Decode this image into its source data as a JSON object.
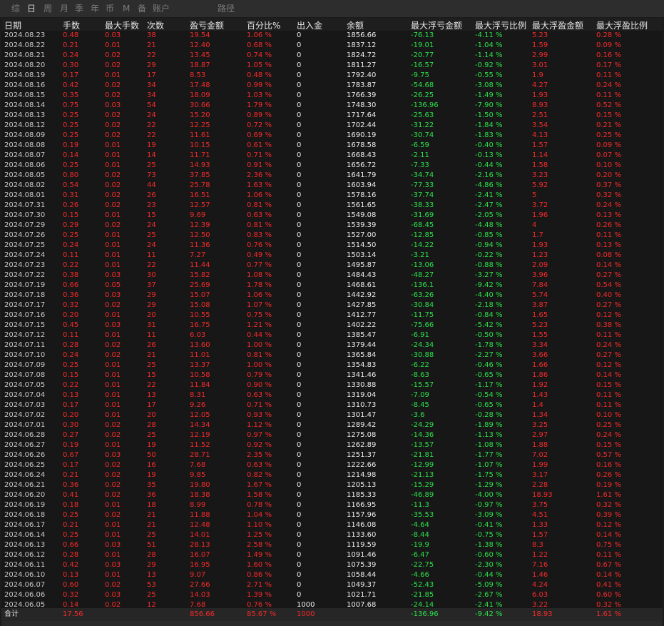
{
  "tabs": [
    {
      "label": "综",
      "active": false
    },
    {
      "label": "日",
      "active": true
    },
    {
      "label": "周",
      "active": false
    },
    {
      "label": "月",
      "active": false
    },
    {
      "label": "季",
      "active": false
    },
    {
      "label": "年",
      "active": false
    },
    {
      "label": "币",
      "active": false
    },
    {
      "label": "M",
      "active": false
    },
    {
      "label": "备",
      "active": false
    },
    {
      "label": "账户",
      "active": false
    },
    {
      "label": "路径",
      "active": false
    }
  ],
  "columns": [
    "日期",
    "手数",
    "最大手数",
    "次数",
    "盈亏金额",
    "百分比%",
    "出入金",
    "余额",
    "最大浮亏金额",
    "最大浮亏比例",
    "最大浮盈金额",
    "最大浮盈比例"
  ],
  "rows": [
    [
      "2024.08.23",
      "0.48",
      "0.03",
      "38",
      "19.54",
      "1.06 %",
      "0",
      "1856.66",
      "-76.13",
      "-4.11 %",
      "5.23",
      "0.28 %"
    ],
    [
      "2024.08.22",
      "0.21",
      "0.01",
      "21",
      "12.40",
      "0.68 %",
      "0",
      "1837.12",
      "-19.01",
      "-1.04 %",
      "1.59",
      "0.09 %"
    ],
    [
      "2024.08.21",
      "0.24",
      "0.02",
      "22",
      "13.45",
      "0.74 %",
      "0",
      "1824.72",
      "-20.77",
      "-1.14 %",
      "2.99",
      "0.16 %"
    ],
    [
      "2024.08.20",
      "0.30",
      "0.02",
      "29",
      "18.87",
      "1.05 %",
      "0",
      "1811.27",
      "-16.57",
      "-0.92 %",
      "3.01",
      "0.17 %"
    ],
    [
      "2024.08.19",
      "0.17",
      "0.01",
      "17",
      "8.53",
      "0.48 %",
      "0",
      "1792.40",
      "-9.75",
      "-0.55 %",
      "1.9",
      "0.11 %"
    ],
    [
      "2024.08.16",
      "0.42",
      "0.02",
      "34",
      "17.48",
      "0.99 %",
      "0",
      "1783.87",
      "-54.68",
      "-3.08 %",
      "4.27",
      "0.24 %"
    ],
    [
      "2024.08.15",
      "0.35",
      "0.02",
      "34",
      "18.09",
      "1.03 %",
      "0",
      "1766.39",
      "-26.25",
      "-1.49 %",
      "1.93",
      "0.11 %"
    ],
    [
      "2024.08.14",
      "0.75",
      "0.03",
      "54",
      "30.66",
      "1.79 %",
      "0",
      "1748.30",
      "-136.96",
      "-7.90 %",
      "8.93",
      "0.52 %"
    ],
    [
      "2024.08.13",
      "0.25",
      "0.02",
      "24",
      "15.20",
      "0.89 %",
      "0",
      "1717.64",
      "-25.63",
      "-1.50 %",
      "2.51",
      "0.15 %"
    ],
    [
      "2024.08.12",
      "0.25",
      "0.02",
      "22",
      "12.25",
      "0.72 %",
      "0",
      "1702.44",
      "-31.22",
      "-1.84 %",
      "3.54",
      "0.21 %"
    ],
    [
      "2024.08.09",
      "0.25",
      "0.02",
      "22",
      "11.61",
      "0.69 %",
      "0",
      "1690.19",
      "-30.74",
      "-1.83 %",
      "4.13",
      "0.25 %"
    ],
    [
      "2024.08.08",
      "0.19",
      "0.01",
      "19",
      "10.15",
      "0.61 %",
      "0",
      "1678.58",
      "-6.59",
      "-0.40 %",
      "1.57",
      "0.09 %"
    ],
    [
      "2024.08.07",
      "0.14",
      "0.01",
      "14",
      "11.71",
      "0.71 %",
      "0",
      "1668.43",
      "-2.11",
      "-0.13 %",
      "1.14",
      "0.07 %"
    ],
    [
      "2024.08.06",
      "0.25",
      "0.01",
      "25",
      "14.93",
      "0.91 %",
      "0",
      "1656.72",
      "-7.33",
      "-0.44 %",
      "1.58",
      "0.10 %"
    ],
    [
      "2024.08.05",
      "0.80",
      "0.02",
      "73",
      "37.85",
      "2.36 %",
      "0",
      "1641.79",
      "-34.74",
      "-2.16 %",
      "3.23",
      "0.20 %"
    ],
    [
      "2024.08.02",
      "0.54",
      "0.02",
      "44",
      "25.78",
      "1.63 %",
      "0",
      "1603.94",
      "-77.33",
      "-4.86 %",
      "5.92",
      "0.37 %"
    ],
    [
      "2024.08.01",
      "0.31",
      "0.02",
      "26",
      "16.51",
      "1.06 %",
      "0",
      "1578.16",
      "-37.74",
      "-2.41 %",
      "5",
      "0.32 %"
    ],
    [
      "2024.07.31",
      "0.26",
      "0.02",
      "23",
      "12.57",
      "0.81 %",
      "0",
      "1561.65",
      "-38.33",
      "-2.47 %",
      "3.72",
      "0.24 %"
    ],
    [
      "2024.07.30",
      "0.15",
      "0.01",
      "15",
      "9.69",
      "0.63 %",
      "0",
      "1549.08",
      "-31.69",
      "-2.05 %",
      "1.96",
      "0.13 %"
    ],
    [
      "2024.07.29",
      "0.29",
      "0.02",
      "24",
      "12.39",
      "0.81 %",
      "0",
      "1539.39",
      "-68.45",
      "-4.48 %",
      "4",
      "0.26 %"
    ],
    [
      "2024.07.26",
      "0.25",
      "0.01",
      "25",
      "12.50",
      "0.83 %",
      "0",
      "1527.00",
      "-12.85",
      "-0.85 %",
      "1.7",
      "0.11 %"
    ],
    [
      "2024.07.25",
      "0.24",
      "0.01",
      "24",
      "11.36",
      "0.76 %",
      "0",
      "1514.50",
      "-14.22",
      "-0.94 %",
      "1.93",
      "0.13 %"
    ],
    [
      "2024.07.24",
      "0.11",
      "0.01",
      "11",
      "7.27",
      "0.49 %",
      "0",
      "1503.14",
      "-3.21",
      "-0.22 %",
      "1.23",
      "0.08 %"
    ],
    [
      "2024.07.23",
      "0.22",
      "0.01",
      "22",
      "11.44",
      "0.77 %",
      "0",
      "1495.87",
      "-13.06",
      "-0.88 %",
      "2.09",
      "0.14 %"
    ],
    [
      "2024.07.22",
      "0.38",
      "0.03",
      "30",
      "15.82",
      "1.08 %",
      "0",
      "1484.43",
      "-48.27",
      "-3.27 %",
      "3.96",
      "0.27 %"
    ],
    [
      "2024.07.19",
      "0.66",
      "0.05",
      "37",
      "25.69",
      "1.78 %",
      "0",
      "1468.61",
      "-136.1",
      "-9.42 %",
      "7.84",
      "0.54 %"
    ],
    [
      "2024.07.18",
      "0.36",
      "0.03",
      "29",
      "15.07",
      "1.06 %",
      "0",
      "1442.92",
      "-63.26",
      "-4.40 %",
      "5.74",
      "0.40 %"
    ],
    [
      "2024.07.17",
      "0.32",
      "0.02",
      "29",
      "15.08",
      "1.07 %",
      "0",
      "1427.85",
      "-30.84",
      "-2.18 %",
      "3.87",
      "0.27 %"
    ],
    [
      "2024.07.16",
      "0.20",
      "0.01",
      "20",
      "10.55",
      "0.75 %",
      "0",
      "1412.77",
      "-11.75",
      "-0.84 %",
      "1.65",
      "0.12 %"
    ],
    [
      "2024.07.15",
      "0.45",
      "0.03",
      "31",
      "16.75",
      "1.21 %",
      "0",
      "1402.22",
      "-75.66",
      "-5.42 %",
      "5.23",
      "0.38 %"
    ],
    [
      "2024.07.12",
      "0.11",
      "0.01",
      "11",
      "6.03",
      "0.44 %",
      "0",
      "1385.47",
      "-6.91",
      "-0.50 %",
      "1.55",
      "0.11 %"
    ],
    [
      "2024.07.11",
      "0.28",
      "0.02",
      "26",
      "13.60",
      "1.00 %",
      "0",
      "1379.44",
      "-24.34",
      "-1.78 %",
      "3.34",
      "0.24 %"
    ],
    [
      "2024.07.10",
      "0.24",
      "0.02",
      "21",
      "11.01",
      "0.81 %",
      "0",
      "1365.84",
      "-30.88",
      "-2.27 %",
      "3.66",
      "0.27 %"
    ],
    [
      "2024.07.09",
      "0.25",
      "0.01",
      "25",
      "13.37",
      "1.00 %",
      "0",
      "1354.83",
      "-6.22",
      "-0.46 %",
      "1.66",
      "0.12 %"
    ],
    [
      "2024.07.08",
      "0.15",
      "0.01",
      "15",
      "10.58",
      "0.79 %",
      "0",
      "1341.46",
      "-8.63",
      "-0.65 %",
      "1.86",
      "0.14 %"
    ],
    [
      "2024.07.05",
      "0.22",
      "0.01",
      "22",
      "11.84",
      "0.90 %",
      "0",
      "1330.88",
      "-15.57",
      "-1.17 %",
      "1.92",
      "0.15 %"
    ],
    [
      "2024.07.04",
      "0.13",
      "0.01",
      "13",
      "8.31",
      "0.63 %",
      "0",
      "1319.04",
      "-7.09",
      "-0.54 %",
      "1.43",
      "0.11 %"
    ],
    [
      "2024.07.03",
      "0.17",
      "0.01",
      "17",
      "9.26",
      "0.71 %",
      "0",
      "1310.73",
      "-8.45",
      "-0.65 %",
      "1.4",
      "0.11 %"
    ],
    [
      "2024.07.02",
      "0.20",
      "0.01",
      "20",
      "12.05",
      "0.93 %",
      "0",
      "1301.47",
      "-3.6",
      "-0.28 %",
      "1.34",
      "0.10 %"
    ],
    [
      "2024.07.01",
      "0.30",
      "0.02",
      "28",
      "14.34",
      "1.12 %",
      "0",
      "1289.42",
      "-24.29",
      "-1.89 %",
      "3.25",
      "0.25 %"
    ],
    [
      "2024.06.28",
      "0.27",
      "0.02",
      "25",
      "12.19",
      "0.97 %",
      "0",
      "1275.08",
      "-14.36",
      "-1.13 %",
      "2.97",
      "0.24 %"
    ],
    [
      "2024.06.27",
      "0.19",
      "0.01",
      "19",
      "11.52",
      "0.92 %",
      "0",
      "1262.89",
      "-13.57",
      "-1.08 %",
      "1.88",
      "0.15 %"
    ],
    [
      "2024.06.26",
      "0.67",
      "0.03",
      "50",
      "28.71",
      "2.35 %",
      "0",
      "1251.37",
      "-21.81",
      "-1.77 %",
      "7.02",
      "0.57 %"
    ],
    [
      "2024.06.25",
      "0.17",
      "0.02",
      "16",
      "7.68",
      "0.63 %",
      "0",
      "1222.66",
      "-12.99",
      "-1.07 %",
      "1.99",
      "0.16 %"
    ],
    [
      "2024.06.24",
      "0.21",
      "0.02",
      "19",
      "9.85",
      "0.82 %",
      "0",
      "1214.98",
      "-21.13",
      "-1.75 %",
      "3.17",
      "0.26 %"
    ],
    [
      "2024.06.21",
      "0.36",
      "0.02",
      "35",
      "19.80",
      "1.67 %",
      "0",
      "1205.13",
      "-15.29",
      "-1.29 %",
      "2.28",
      "0.19 %"
    ],
    [
      "2024.06.20",
      "0.41",
      "0.02",
      "36",
      "18.38",
      "1.58 %",
      "0",
      "1185.33",
      "-46.89",
      "-4.00 %",
      "18.93",
      "1.61 %"
    ],
    [
      "2024.06.19",
      "0.18",
      "0.01",
      "18",
      "8.99",
      "0.78 %",
      "0",
      "1166.95",
      "-11.3",
      "-0.97 %",
      "3.75",
      "0.32 %"
    ],
    [
      "2024.06.18",
      "0.25",
      "0.02",
      "21",
      "11.88",
      "1.04 %",
      "0",
      "1157.96",
      "-35.53",
      "-3.09 %",
      "4.51",
      "0.39 %"
    ],
    [
      "2024.06.17",
      "0.21",
      "0.01",
      "21",
      "12.48",
      "1.10 %",
      "0",
      "1146.08",
      "-4.64",
      "-0.41 %",
      "1.33",
      "0.12 %"
    ],
    [
      "2024.06.14",
      "0.25",
      "0.01",
      "25",
      "14.01",
      "1.25 %",
      "0",
      "1133.60",
      "-8.44",
      "-0.75 %",
      "1.57",
      "0.14 %"
    ],
    [
      "2024.06.13",
      "0.66",
      "0.03",
      "51",
      "28.13",
      "2.58 %",
      "0",
      "1119.59",
      "-19.9",
      "-1.38 %",
      "8.3",
      "0.75 %"
    ],
    [
      "2024.06.12",
      "0.28",
      "0.01",
      "28",
      "16.07",
      "1.49 %",
      "0",
      "1091.46",
      "-6.47",
      "-0.60 %",
      "1.22",
      "0.11 %"
    ],
    [
      "2024.06.11",
      "0.42",
      "0.03",
      "29",
      "16.95",
      "1.60 %",
      "0",
      "1075.39",
      "-22.75",
      "-2.30 %",
      "7.16",
      "0.67 %"
    ],
    [
      "2024.06.10",
      "0.13",
      "0.01",
      "13",
      "9.07",
      "0.86 %",
      "0",
      "1058.44",
      "-4.66",
      "-0.44 %",
      "1.46",
      "0.14 %"
    ],
    [
      "2024.06.07",
      "0.60",
      "0.02",
      "53",
      "27.66",
      "2.71 %",
      "0",
      "1049.37",
      "-52.43",
      "-5.09 %",
      "4.24",
      "0.41 %"
    ],
    [
      "2024.06.06",
      "0.32",
      "0.03",
      "25",
      "14.03",
      "1.39 %",
      "0",
      "1021.71",
      "-21.85",
      "-2.67 %",
      "6.03",
      "0.60 %"
    ],
    [
      "2024.06.05",
      "0.14",
      "0.02",
      "12",
      "7.68",
      "0.76 %",
      "1000",
      "1007.68",
      "-24.14",
      "-2.41 %",
      "3.22",
      "0.32 %"
    ]
  ],
  "total": [
    "合计",
    "17.56",
    "",
    "",
    "856.66",
    "85.67 %",
    "1000",
    "",
    "-136.96",
    "-9.42 %",
    "18.93",
    "1.61 %"
  ]
}
